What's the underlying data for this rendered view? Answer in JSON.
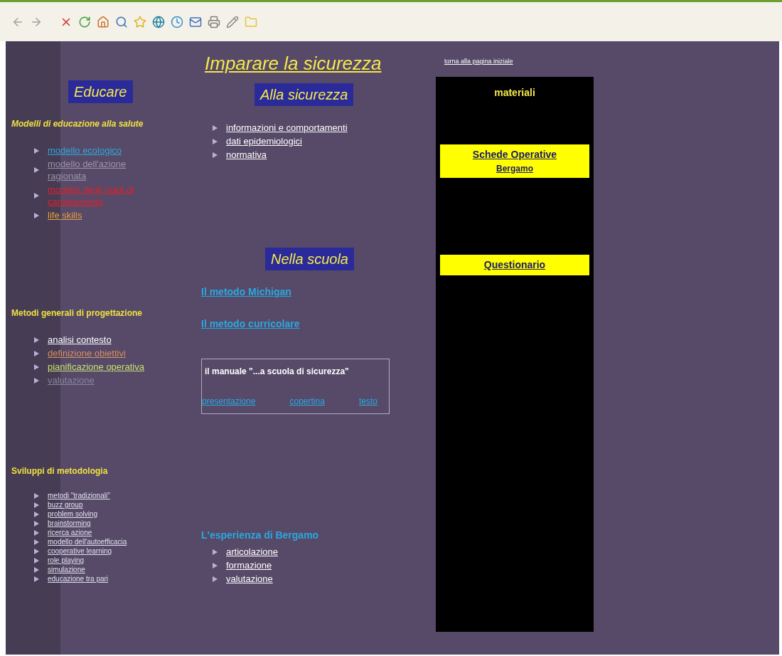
{
  "page_title": "Imparare la sicurezza",
  "home_link": "torna alla pagina iniziale",
  "left": {
    "heading": "Educare",
    "sections": [
      {
        "title": "Modelli di educazione alla salute",
        "kind": "regular",
        "items": [
          {
            "label": "modello ecologico",
            "color": "#2fa8d8"
          },
          {
            "label": "modello dell'azione ragionata",
            "color": "#9a93a8"
          },
          {
            "label": "modello degli stadi di cambiamento",
            "color": "#e0202a"
          },
          {
            "label": "life skills",
            "color": "#e8a040"
          }
        ]
      },
      {
        "title": "Metodi generali di progettazione",
        "kind": "regular",
        "items": [
          {
            "label": "analisi contesto",
            "color": "#ffffff"
          },
          {
            "label": "definizione obiettivi",
            "color": "#d89060"
          },
          {
            "label": "pianificazione operativa",
            "color": "#c8e070"
          },
          {
            "label": "valutazione",
            "color": "#8a84a0"
          }
        ]
      },
      {
        "title": "Sviluppi di metodologia",
        "kind": "compact",
        "items": [
          {
            "label": "metodi \"tradizionali\""
          },
          {
            "label": "buzz group"
          },
          {
            "label": "problem solving"
          },
          {
            "label": "brainstorming"
          },
          {
            "label": "ricerca azione"
          },
          {
            "label": "modello dell'autoefficacia"
          },
          {
            "label": "cooperative learning"
          },
          {
            "label": "role playing"
          },
          {
            "label": "simulazione"
          },
          {
            "label": "educazione tra pari"
          }
        ]
      }
    ]
  },
  "middle": {
    "heading": "Alla sicurezza",
    "items": [
      {
        "label": "informazioni e comportamenti"
      },
      {
        "label": "dati epidemiologici"
      },
      {
        "label": "normativa"
      }
    ],
    "school_heading": "Nella scuola",
    "methods": [
      "Il metodo Michigan",
      "Il metodo curricolare"
    ],
    "manual": {
      "title": "il manuale  \"...a scuola di sicurezza\"",
      "links": [
        "presentazione",
        "copertina",
        "testo"
      ]
    },
    "experience": {
      "title": "L'esperienza di Bergamo",
      "items": [
        {
          "label": "articolazione"
        },
        {
          "label": "formazione"
        },
        {
          "label": "valutazione"
        }
      ]
    }
  },
  "materials": {
    "title": "materiali",
    "buttons": [
      {
        "lines": [
          "Schede Operative",
          "Bergamo"
        ]
      },
      {
        "lines": [
          "Questionario"
        ]
      }
    ]
  }
}
